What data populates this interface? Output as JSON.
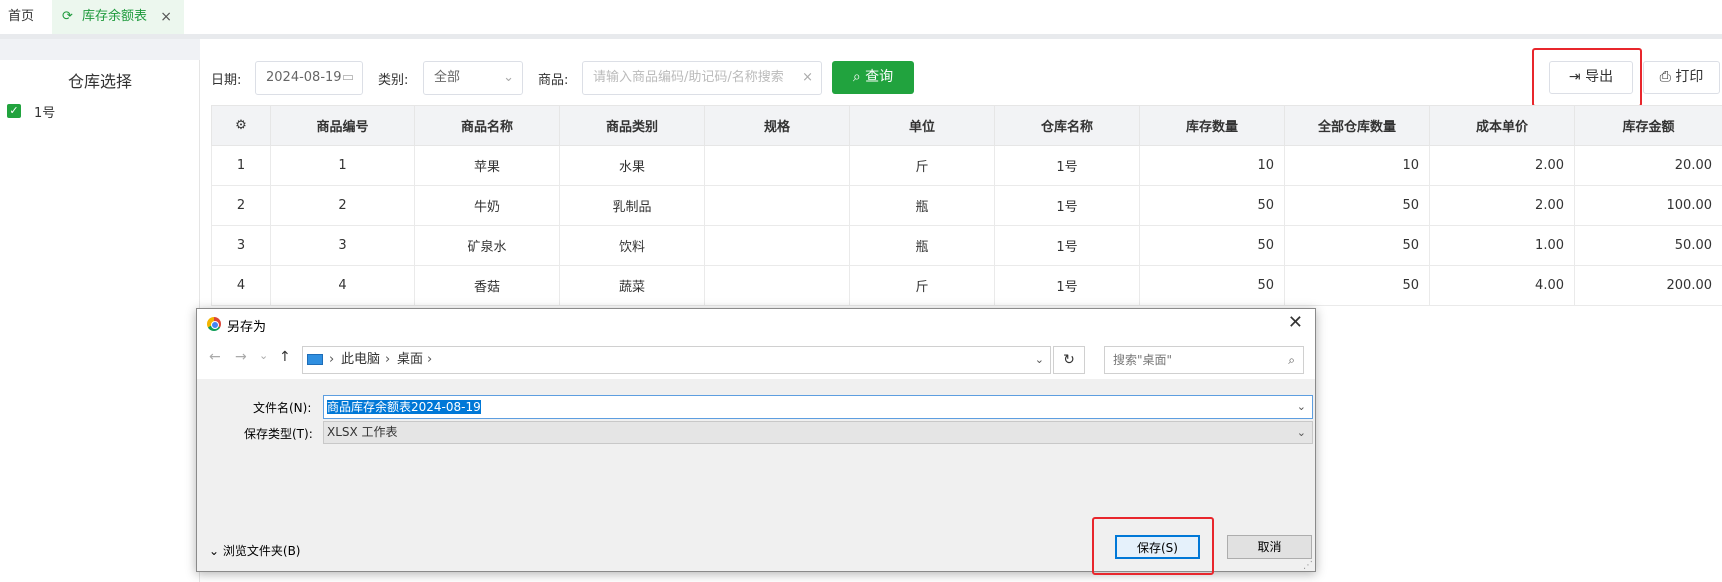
{
  "tabs": {
    "home": "首页",
    "active": "库存余额表"
  },
  "left": {
    "title": "仓库选择",
    "warehouse": "1号"
  },
  "filters": {
    "date_label": "日期:",
    "date_value": "2024-08-19",
    "category_label": "类别:",
    "category_value": "全部",
    "product_label": "商品:",
    "product_placeholder": "请输入商品编码/助记码/名称搜索"
  },
  "buttons": {
    "query": "查询",
    "export": "导出",
    "print": "打印"
  },
  "table": {
    "headers": [
      "商品编号",
      "商品名称",
      "商品类别",
      "规格",
      "单位",
      "仓库名称",
      "库存数量",
      "全部仓库数量",
      "成本单价",
      "库存金额"
    ],
    "rows": [
      {
        "idx": "1",
        "code": "1",
        "name": "苹果",
        "category": "水果",
        "spec": "",
        "unit": "斤",
        "warehouse": "1号",
        "qty": "10",
        "all_qty": "10",
        "cost": "2.00",
        "amount": "20.00"
      },
      {
        "idx": "2",
        "code": "2",
        "name": "牛奶",
        "category": "乳制品",
        "spec": "",
        "unit": "瓶",
        "warehouse": "1号",
        "qty": "50",
        "all_qty": "50",
        "cost": "2.00",
        "amount": "100.00"
      },
      {
        "idx": "3",
        "code": "3",
        "name": "矿泉水",
        "category": "饮料",
        "spec": "",
        "unit": "瓶",
        "warehouse": "1号",
        "qty": "50",
        "all_qty": "50",
        "cost": "1.00",
        "amount": "50.00"
      },
      {
        "idx": "4",
        "code": "4",
        "name": "香菇",
        "category": "蔬菜",
        "spec": "",
        "unit": "斤",
        "warehouse": "1号",
        "qty": "50",
        "all_qty": "50",
        "cost": "4.00",
        "amount": "200.00"
      }
    ]
  },
  "dialog": {
    "title": "另存为",
    "path": [
      "此电脑",
      "桌面"
    ],
    "search_placeholder": "搜索\"桌面\"",
    "filename_label": "文件名(N):",
    "filename_value": "商品库存余额表2024-08-19",
    "type_label": "保存类型(T):",
    "type_value": "XLSX 工作表",
    "browse_label": "浏览文件夹(B)",
    "save": "保存(S)",
    "cancel": "取消"
  },
  "colors": {
    "accent": "#21a33e",
    "highlight": "#e8262c",
    "selection": "#0078d7"
  }
}
